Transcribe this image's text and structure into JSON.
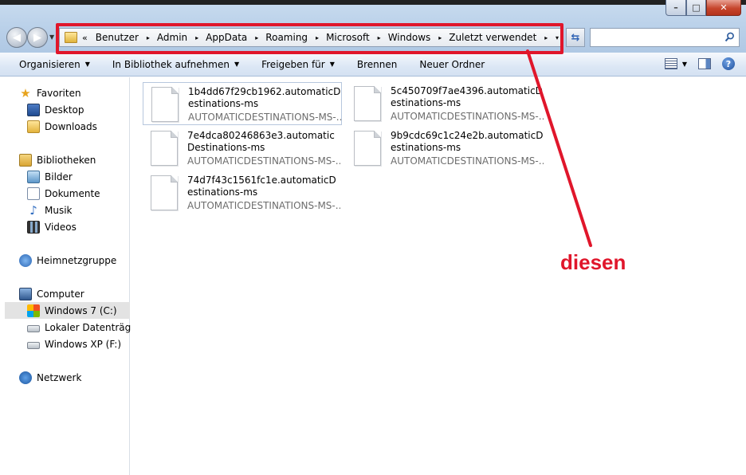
{
  "window": {
    "controls": {
      "minimize": "–",
      "maximize": "□",
      "close": "✕"
    }
  },
  "address_bar": {
    "overflow": "«",
    "crumbs": [
      "Benutzer",
      "Admin",
      "AppData",
      "Roaming",
      "Microsoft",
      "Windows",
      "Zuletzt verwendet"
    ],
    "separator": "▸",
    "dropdown": "▾"
  },
  "search": {
    "placeholder": ""
  },
  "toolbar": {
    "organize": "Organisieren",
    "include_library": "In Bibliothek aufnehmen",
    "share": "Freigeben für",
    "burn": "Brennen",
    "new_folder": "Neuer Ordner",
    "help": "?"
  },
  "nav_pane": {
    "favorites": "Favoriten",
    "desktop": "Desktop",
    "downloads": "Downloads",
    "libraries": "Bibliotheken",
    "pictures": "Bilder",
    "documents": "Dokumente",
    "music": "Musik",
    "videos": "Videos",
    "homegroup": "Heimnetzgruppe",
    "computer": "Computer",
    "drive_c": "Windows 7 (C:)",
    "drive_local": "Lokaler Datenträger",
    "drive_f": "Windows XP (F:)",
    "network": "Netzwerk"
  },
  "files": [
    {
      "name": "1b4dd67f29cb1962.automaticDestinations-ms",
      "type": "AUTOMATICDESTINATIONS-MS-..."
    },
    {
      "name": "5c450709f7ae4396.automaticDestinations-ms",
      "type": "AUTOMATICDESTINATIONS-MS-..."
    },
    {
      "name": "7e4dca80246863e3.automaticDestinations-ms",
      "type": "AUTOMATICDESTINATIONS-MS-..."
    },
    {
      "name": "9b9cdc69c1c24e2b.automaticDestinations-ms",
      "type": "AUTOMATICDESTINATIONS-MS-..."
    },
    {
      "name": "74d7f43c1561fc1e.automaticDestinations-ms",
      "type": "AUTOMATICDESTINATIONS-MS-..."
    }
  ],
  "annotation": {
    "label": "diesen",
    "color": "#e0162b"
  },
  "colors": {
    "chrome": "#bcd2ea",
    "command_bar": "#dce7f5",
    "selection": "#e3e3e3"
  }
}
